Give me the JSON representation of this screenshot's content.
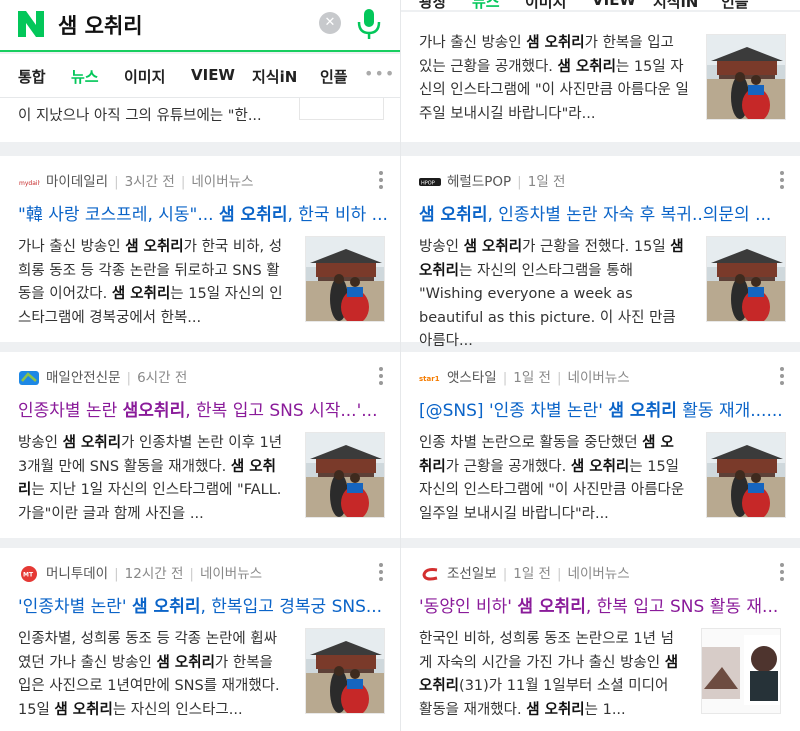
{
  "search": {
    "query": "샘 오취리",
    "clear_label": "✕"
  },
  "tabs": [
    "통합",
    "뉴스",
    "이미지",
    "VIEW",
    "지식iN",
    "인플"
  ],
  "tabs_partial_right": [
    "광장",
    "뉴스",
    "이미지",
    "VIEW",
    "지식iN",
    "인플"
  ],
  "more_label": "•••",
  "partial_left_text": "이 지났으나 아직 그의 유튜브에는 \"한...",
  "partial_right_snippet": [
    {
      "t": "가나 출신 방송인 "
    },
    {
      "t": "샘 오취리",
      "b": true
    },
    {
      "t": "가 한복을 입고 있는 근황을 공개했다. "
    },
    {
      "t": "샘 오취리",
      "b": true
    },
    {
      "t": "는 15일 자신의 인스타그램에 \"이 사진만큼 아름다운 일주일 보내시길 바랍니다\"라..."
    }
  ],
  "articles": [
    {
      "publisher": "마이데일리",
      "time": "3시간 전",
      "source": "네이버뉴스",
      "icon": "mydaily-logo",
      "visited": false,
      "title": [
        {
          "t": "\"韓 사랑 코스프레, 시동\"... "
        },
        {
          "t": "샘 오취리",
          "b": true
        },
        {
          "t": ", 한국 비하 ..."
        }
      ],
      "snippet": [
        {
          "t": "가나 출신 방송인 "
        },
        {
          "t": "샘 오취리",
          "b": true
        },
        {
          "t": "가 한국 비하, 성희롱 동조 등 각종 논란을 뒤로하고 SNS 활동을 이어갔다. "
        },
        {
          "t": "샘 오취리",
          "b": true
        },
        {
          "t": "는 15일 자신의 인스타그램에 경복궁에서 한복..."
        }
      ],
      "thumb": "palace"
    },
    {
      "publisher": "헤럴드POP",
      "time": "1일 전",
      "source": "",
      "icon": "heraldpop-logo",
      "visited": false,
      "title": [
        {
          "t": "샘 오취리",
          "b": true
        },
        {
          "t": ", 인종차별 논란 자숙 후 복귀..의문의 ..."
        }
      ],
      "snippet": [
        {
          "t": "방송인 "
        },
        {
          "t": "샘 오취리",
          "b": true
        },
        {
          "t": "가 근황을 전했다. 15일 "
        },
        {
          "t": "샘 오취리",
          "b": true
        },
        {
          "t": "는 자신의 인스타그램을 통해 \"Wishing everyone a week as beautiful as this picture. 이 사진 만큼 아름다..."
        }
      ],
      "thumb": "palace"
    },
    {
      "publisher": "매일안전신문",
      "time": "6시간 전",
      "source": "",
      "icon": "safety-logo",
      "visited": true,
      "title": [
        {
          "t": "인종차별 논란 "
        },
        {
          "t": "샘오취리",
          "b": true
        },
        {
          "t": ", 한복 입고 SNS 시작...'..."
        }
      ],
      "snippet": [
        {
          "t": " 방송인 "
        },
        {
          "t": "샘 오취리",
          "b": true
        },
        {
          "t": "가 인종차별 논란 이후 1년 3개월 만에 SNS 활동을 재개했다. "
        },
        {
          "t": "샘 오취리",
          "b": true
        },
        {
          "t": "는 지난 1일 자신의 인스타그램에 \"FALL. 가을\"이란 글과 함께 사진을 ..."
        }
      ],
      "thumb": "palace"
    },
    {
      "publisher": "앳스타일",
      "time": "1일 전",
      "source": "네이버뉴스",
      "icon": "star1-logo",
      "visited": false,
      "title": [
        {
          "t": "[@SNS] '인종 차별 논란' "
        },
        {
          "t": "샘 오취리",
          "b": true
        },
        {
          "t": " 활동 재개......"
        }
      ],
      "snippet": [
        {
          "t": "인종 차별 논란으로 활동을 중단했던 "
        },
        {
          "t": "샘 오취리",
          "b": true
        },
        {
          "t": "가 근황을 공개했다. "
        },
        {
          "t": "샘 오취리",
          "b": true
        },
        {
          "t": "는 15일 자신의 인스타그램에 \"이 사진만큼 아름다운 일주일 보내시길 바랍니다\"라..."
        }
      ],
      "thumb": "palace"
    },
    {
      "publisher": "머니투데이",
      "time": "12시간 전",
      "source": "네이버뉴스",
      "icon": "mt-logo",
      "visited": false,
      "title": [
        {
          "t": "'인종차별 논란' "
        },
        {
          "t": "샘 오취리",
          "b": true
        },
        {
          "t": ", 한복입고 경복궁 SNS..."
        }
      ],
      "snippet": [
        {
          "t": "인종차별, 성희롱 동조 등 각종 논란에 휩싸였던 가나 출신 방송인 "
        },
        {
          "t": "샘 오취리",
          "b": true
        },
        {
          "t": "가 한복을 입은 사진으로 1년여만에 SNS를 재개했다. 15일 "
        },
        {
          "t": "샘 오취리",
          "b": true
        },
        {
          "t": "는 자신의 인스타그..."
        }
      ],
      "thumb": "palace"
    },
    {
      "publisher": "조선일보",
      "time": "1일 전",
      "source": "네이버뉴스",
      "icon": "chosun-logo",
      "visited": true,
      "title": [
        {
          "t": "'동양인 비하' "
        },
        {
          "t": "샘 오취리",
          "b": true
        },
        {
          "t": ", 한복 입고 SNS 활동 재..."
        }
      ],
      "snippet": [
        {
          "t": "한국인 비하, 성희롱 동조 논란으로 1년 넘게 자숙의 시간을 가진 가나 출신 방송인 "
        },
        {
          "t": "샘 오취리",
          "b": true
        },
        {
          "t": "(31)가 11월 1일부터 소셜 미디어 활동을 재개했다. "
        },
        {
          "t": "샘 오취리",
          "b": true
        },
        {
          "t": "는 1..."
        }
      ],
      "thumb": "portrait"
    }
  ],
  "colors": {
    "naver_green": "#03c75a",
    "link_blue": "#0b64c8",
    "visited_purple": "#8a1b9a"
  }
}
